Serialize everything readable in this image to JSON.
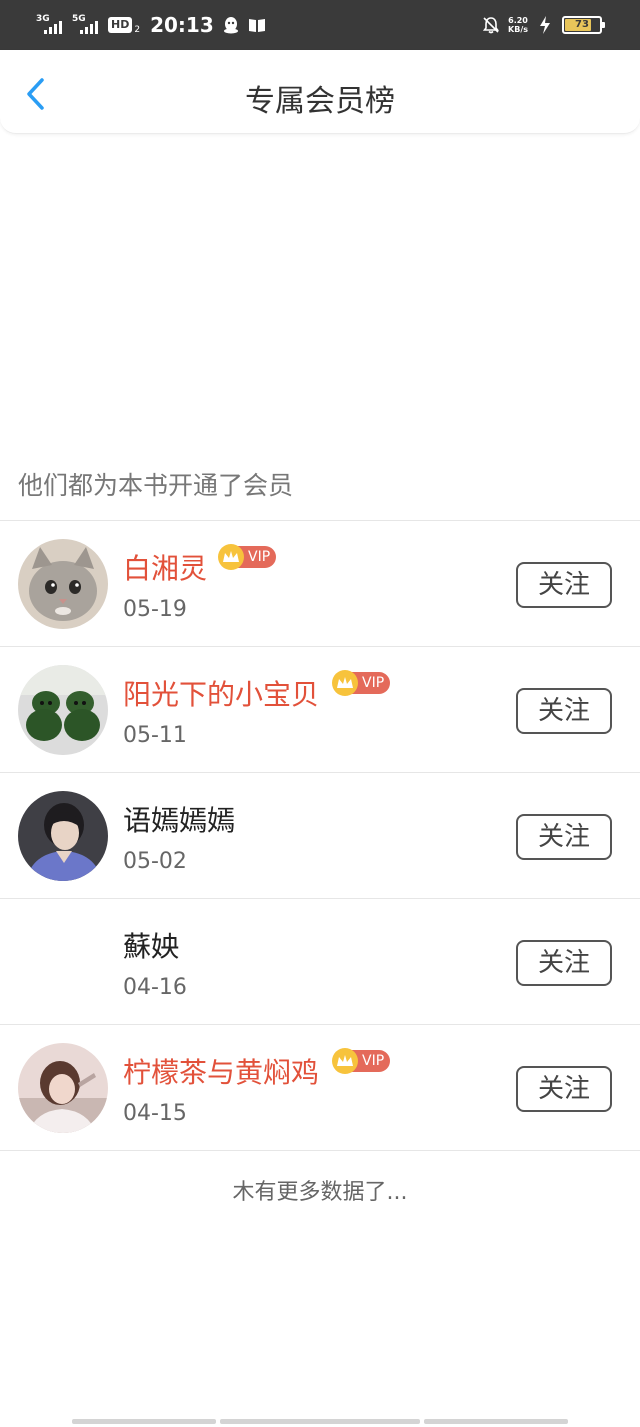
{
  "status_bar": {
    "net1": "3G",
    "net2": "5G",
    "hd": "HD",
    "hd_sub": "2",
    "time": "20:13",
    "speed_value": "6.20",
    "speed_unit": "KB/s",
    "battery": "73",
    "icons": [
      "qq-icon",
      "book-icon",
      "bell-off-icon",
      "charging-icon"
    ]
  },
  "header": {
    "title": "专属会员榜",
    "back_icon": "chevron-left-icon",
    "accent": "#2a9df4"
  },
  "section_label": "他们都为本书开通了会员",
  "vip_badge_text": "VIP",
  "follow_label": "关注",
  "members": [
    {
      "name": "白湘灵",
      "date": "05-19",
      "vip": true,
      "avatar": "kitten-photo"
    },
    {
      "name": "阳光下的小宝贝",
      "date": "05-11",
      "vip": true,
      "avatar": "plush-toys-photo"
    },
    {
      "name": "语嫣嫣嫣",
      "date": "05-02",
      "vip": false,
      "avatar": "person-photo"
    },
    {
      "name": "蘇姎",
      "date": "04-16",
      "vip": false,
      "avatar": ""
    },
    {
      "name": "柠檬茶与黄焖鸡",
      "date": "04-15",
      "vip": true,
      "avatar": "girl-photo"
    }
  ],
  "footer_text": "木有更多数据了...",
  "colors": {
    "vip_name": "#e2513a",
    "vip_tag": "#e46a5a",
    "crown": "#f7c33c"
  }
}
